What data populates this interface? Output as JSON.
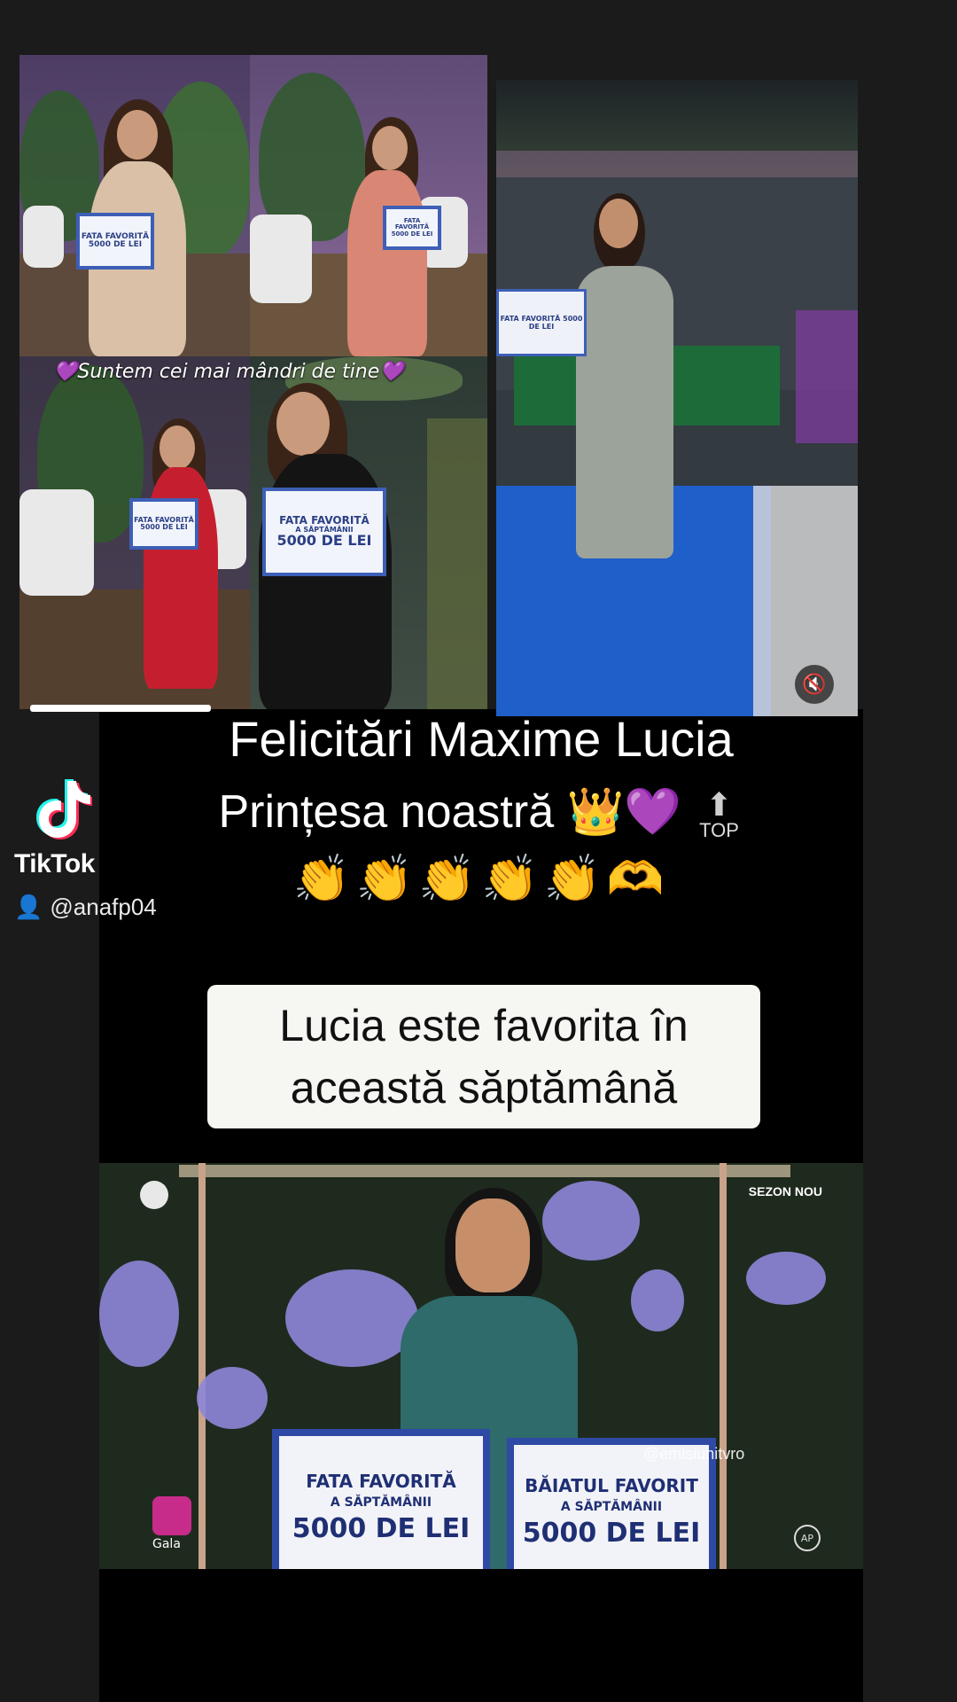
{
  "collage": {
    "caption": "💜Suntem cei mai mândri de tine💜",
    "sign_small": "FATA FAVORITĂ 5000 DE LEI",
    "sign_tile4_line1": "FATA FAVORITĂ",
    "sign_tile4_line2": "A SĂPTĂMÂNII",
    "sign_tile4_line3": "5000 DE LEI"
  },
  "headline": {
    "line1": "Felicitări Maxime Lucia",
    "line2": "Prințesa noastră 👑💜",
    "top_badge": "TOP",
    "line3": "👏👏👏👏👏🫶"
  },
  "tiktok": {
    "brand": "TikTok",
    "username": "@anafp04"
  },
  "subtitle_box": {
    "line1": "Lucia este favorita în",
    "line2": "această săptămână"
  },
  "bottom_photo": {
    "sezon": "SEZON NOU",
    "watermark": "@emisiunitvro",
    "ap": "AP",
    "gala": "Gala",
    "sign_left": {
      "t1": "FATA FAVORITĂ",
      "t2": "A SĂPTĂMÂNII",
      "t3": "5000 DE LEI"
    },
    "sign_right": {
      "t1": "BĂIATUL FAVORIT",
      "t2": "A SĂPTĂMÂNII",
      "t3": "5000 DE LEI"
    }
  },
  "colors": {
    "background": "#1b1b1b",
    "sign_border": "#2f4aa5",
    "caption_box": "#f6f6f2"
  },
  "icons": [
    "tiktok-logo-icon",
    "user-icon",
    "mute-icon",
    "top-arrow-icon"
  ]
}
